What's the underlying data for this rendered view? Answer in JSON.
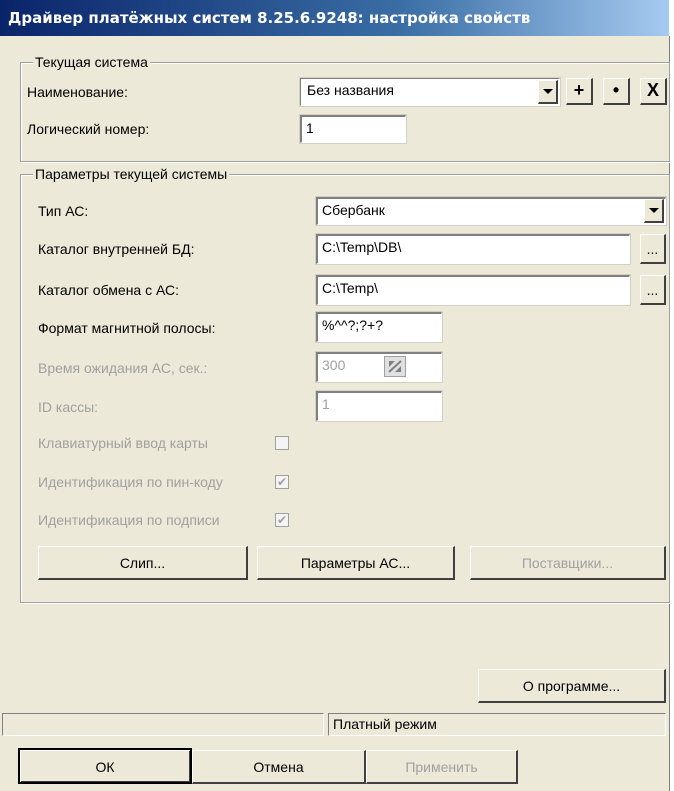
{
  "window": {
    "title": "Драйвер платёжных систем 8.25.6.9248: настройка свойств"
  },
  "current_system": {
    "legend": "Текущая система",
    "name_label": "Наименование:",
    "name_value": "Без названия",
    "add_btn": "+",
    "dot_btn": "•",
    "delete_btn": "X",
    "logical_number_label": "Логический номер:",
    "logical_number_value": "1"
  },
  "params": {
    "legend": "Параметры текущей системы",
    "as_type_label": "Тип АС:",
    "as_type_value": "Сбербанк",
    "db_dir_label": "Каталог внутренней БД:",
    "db_dir_value": "C:\\Temp\\DB\\",
    "exchange_dir_label": "Каталог обмена с АС:",
    "exchange_dir_value": "C:\\Temp\\",
    "browse_btn": "...",
    "magstripe_label": "Формат магнитной полосы:",
    "magstripe_value": "%^^?;?+?",
    "timeout_label": "Время ожидания АС, сек.:",
    "timeout_value": "300",
    "cashbox_id_label": "ID кассы:",
    "cashbox_id_value": "1",
    "keyboard_card_label": "Клавиатурный ввод карты",
    "keyboard_card_checked": false,
    "pin_ident_label": "Идентификация по пин-коду",
    "pin_ident_checked": true,
    "sign_ident_label": "Идентификация по подписи",
    "sign_ident_checked": true,
    "slip_btn": "Слип...",
    "as_params_btn": "Параметры АС...",
    "suppliers_btn": "Поставщики..."
  },
  "about_btn": "О программе...",
  "status": {
    "cell1": "",
    "mode": "Платный режим"
  },
  "footer": {
    "ok": "ОК",
    "cancel": "Отмена",
    "apply": "Применить"
  }
}
